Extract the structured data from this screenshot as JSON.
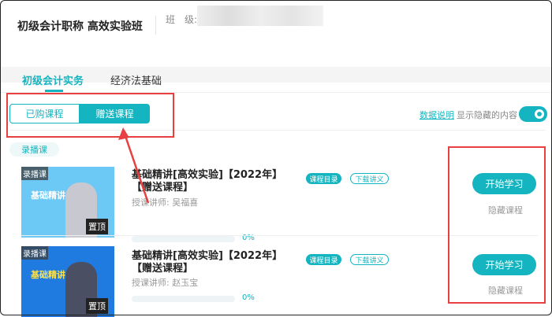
{
  "header": {
    "title": "初级会计职称 高效实验班",
    "class_label": "班　级:"
  },
  "tabs": [
    {
      "label": "初级会计实务",
      "active": true
    },
    {
      "label": "经济法基础",
      "active": false
    }
  ],
  "segment": {
    "purchased": "已购课程",
    "gifted": "赠送课程"
  },
  "toolbar": {
    "data_link": "数据说明",
    "show_hidden": "显示隐藏的内容",
    "show_hidden_on": true
  },
  "section_pill": "录播课",
  "courses": [
    {
      "badge": "录播课",
      "thumb_text": "基础精讲",
      "pin": "置顶",
      "title": "基础精讲[高效实验]【2022年】【赠送课程】",
      "teacher_label": "授课讲师:",
      "teacher": "吴福喜",
      "progress": "0%",
      "tag_catalog": "课程目录",
      "tag_download": "下载讲义",
      "start": "开始学习",
      "hide": "隐藏课程"
    },
    {
      "badge": "录播课",
      "thumb_text": "基础精讲",
      "pin": "置顶",
      "title": "基础精讲[高效实验]【2022年】【赠送课程】",
      "teacher_label": "授课讲师:",
      "teacher": "赵玉宝",
      "progress": "0%",
      "tag_catalog": "课程目录",
      "tag_download": "下载讲义",
      "start": "开始学习",
      "hide": "隐藏课程"
    }
  ],
  "colors": {
    "accent": "#14b5c0",
    "annotation": "#e84040"
  }
}
